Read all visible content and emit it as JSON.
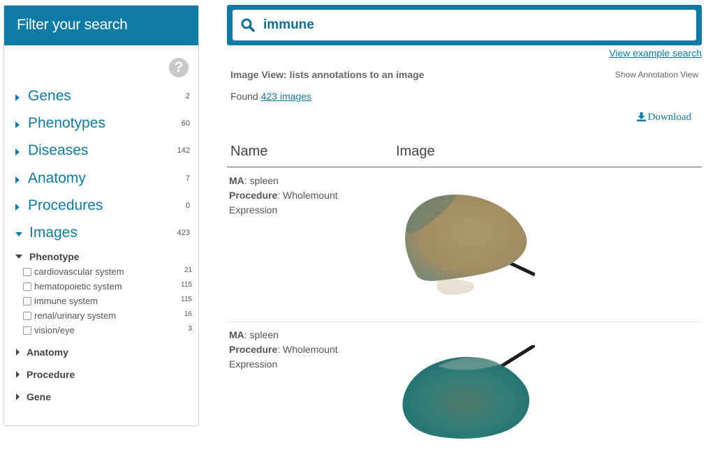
{
  "sidebar": {
    "title": "Filter your search",
    "facets": [
      {
        "label": "Genes",
        "count": "2"
      },
      {
        "label": "Phenotypes",
        "count": "60"
      },
      {
        "label": "Diseases",
        "count": "142"
      },
      {
        "label": "Anatomy",
        "count": "7"
      },
      {
        "label": "Procedures",
        "count": "0"
      },
      {
        "label": "Images",
        "count": "423"
      }
    ],
    "images_sub": {
      "phenotype_label": "Phenotype",
      "options": [
        {
          "label": "cardiovascular system",
          "count": "21"
        },
        {
          "label": "hematopoietic system",
          "count": "115"
        },
        {
          "label": "immune system",
          "count": "115"
        },
        {
          "label": "renal/urinary system",
          "count": "16"
        },
        {
          "label": "vision/eye",
          "count": "3"
        }
      ],
      "anatomy_label": "Anatomy",
      "procedure_label": "Procedure",
      "gene_label": "Gene"
    }
  },
  "search": {
    "value": "immune"
  },
  "example_link": "View example search",
  "view": {
    "title": "Image View: lists annotations to an image",
    "toggle": "Show Annotation View"
  },
  "found": {
    "prefix": "Found ",
    "link": "423 images"
  },
  "download_label": "Download",
  "table": {
    "headers": {
      "name": "Name",
      "image": "Image"
    },
    "rows": [
      {
        "ma_label": "MA",
        "ma": ": spleen",
        "proc_label": "Procedure",
        "proc": ": Wholemount",
        "proc2": "Expression"
      },
      {
        "ma_label": "MA",
        "ma": ": spleen",
        "proc_label": "Procedure",
        "proc": ": Wholemount",
        "proc2": "Expression"
      }
    ]
  },
  "colors": {
    "brand": "#0e7ba6"
  }
}
